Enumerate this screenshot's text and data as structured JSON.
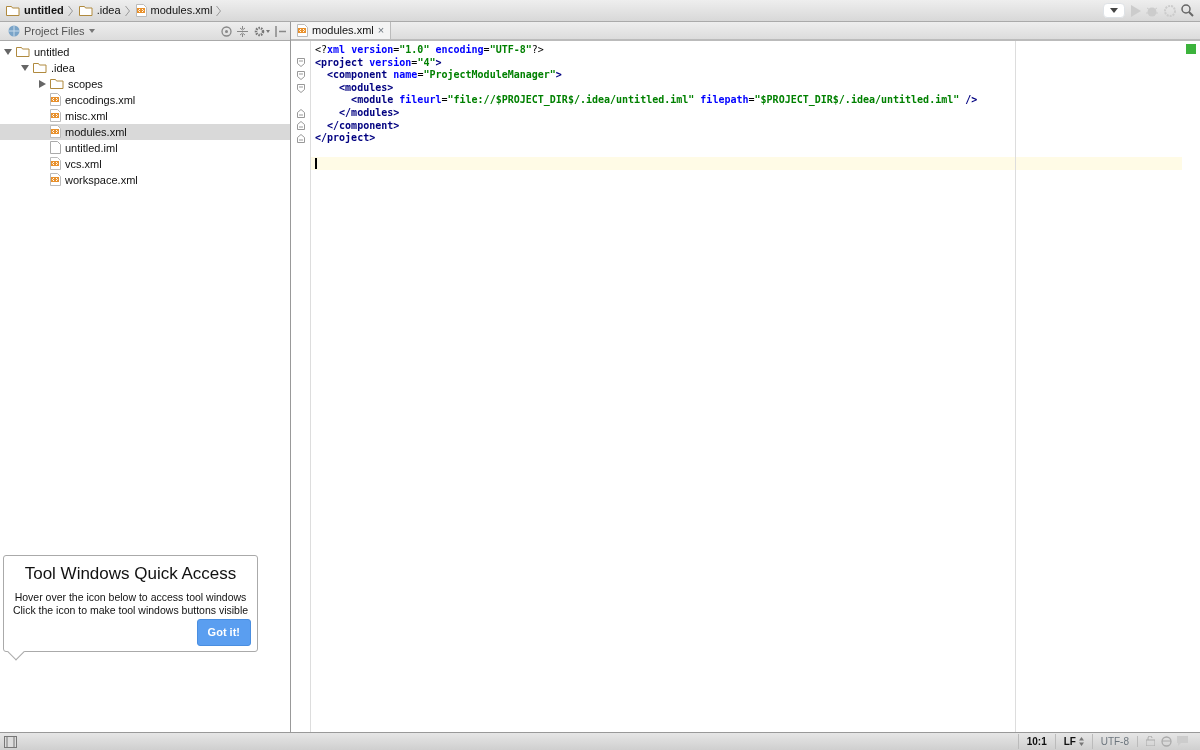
{
  "breadcrumbs": [
    {
      "label": "untitled",
      "kind": "folder",
      "bold": true
    },
    {
      "label": ".idea",
      "kind": "folder",
      "bold": false
    },
    {
      "label": "modules.xml",
      "kind": "xml",
      "bold": false
    }
  ],
  "project_panel": {
    "view_selector": "Project Files",
    "tree": [
      {
        "label": "untitled",
        "kind": "folder",
        "expanded": true,
        "selected": false,
        "children": [
          {
            "label": ".idea",
            "kind": "folder",
            "expanded": true,
            "selected": false,
            "children": [
              {
                "label": "scopes",
                "kind": "folder",
                "expanded": false,
                "selected": false
              },
              {
                "label": "encodings.xml",
                "kind": "xml",
                "selected": false
              },
              {
                "label": "misc.xml",
                "kind": "xml",
                "selected": false
              },
              {
                "label": "modules.xml",
                "kind": "xml",
                "selected": true
              },
              {
                "label": "untitled.iml",
                "kind": "file",
                "selected": false
              },
              {
                "label": "vcs.xml",
                "kind": "xml",
                "selected": false
              },
              {
                "label": "workspace.xml",
                "kind": "xml",
                "selected": false
              }
            ]
          }
        ]
      }
    ]
  },
  "editor_tabs": [
    {
      "label": "modules.xml",
      "selected": true,
      "close": "×"
    }
  ],
  "code_lines": [
    {
      "kind": "plain",
      "tokens": [
        {
          "t": "<?",
          "kind": "plain"
        },
        {
          "t": "xml version",
          "kind": "attr"
        },
        {
          "t": "=",
          "kind": "plain"
        },
        {
          "t": "\"1.0\"",
          "kind": "value"
        },
        {
          "t": " encoding",
          "kind": "attr"
        },
        {
          "t": "=",
          "kind": "plain"
        },
        {
          "t": "\"UTF-8\"",
          "kind": "value"
        },
        {
          "t": "?>",
          "kind": "plain"
        }
      ]
    },
    {
      "kind": "fold_start",
      "tokens": [
        {
          "t": "<project ",
          "kind": "tag"
        },
        {
          "t": "version",
          "kind": "attr"
        },
        {
          "t": "=",
          "kind": "plain"
        },
        {
          "t": "\"4\"",
          "kind": "value"
        },
        {
          "t": ">",
          "kind": "tag"
        }
      ]
    },
    {
      "kind": "fold_start",
      "tokens": [
        {
          "t": "  <component ",
          "kind": "tag"
        },
        {
          "t": "name",
          "kind": "attr"
        },
        {
          "t": "=",
          "kind": "plain"
        },
        {
          "t": "\"ProjectModuleManager\"",
          "kind": "value"
        },
        {
          "t": ">",
          "kind": "tag"
        }
      ]
    },
    {
      "kind": "fold_start",
      "tokens": [
        {
          "t": "    <modules>",
          "kind": "tag"
        }
      ]
    },
    {
      "kind": "plain",
      "tokens": [
        {
          "t": "      <module ",
          "kind": "tag"
        },
        {
          "t": "fileurl",
          "kind": "attr"
        },
        {
          "t": "=",
          "kind": "plain"
        },
        {
          "t": "\"file://$PROJECT_DIR$/.idea/untitled.iml\"",
          "kind": "value"
        },
        {
          "t": " filepath",
          "kind": "attr"
        },
        {
          "t": "=",
          "kind": "plain"
        },
        {
          "t": "\"$PROJECT_DIR$/.idea/untitled.iml\"",
          "kind": "value"
        },
        {
          "t": " />",
          "kind": "tag"
        }
      ]
    },
    {
      "kind": "fold_end",
      "tokens": [
        {
          "t": "    </modules>",
          "kind": "tag"
        }
      ]
    },
    {
      "kind": "fold_end",
      "tokens": [
        {
          "t": "  </component>",
          "kind": "tag"
        }
      ]
    },
    {
      "kind": "fold_end",
      "tokens": [
        {
          "t": "</project>",
          "kind": "tag"
        }
      ]
    },
    {
      "kind": "blank"
    },
    {
      "kind": "blank",
      "caret": true
    }
  ],
  "popup": {
    "title": "Tool Windows Quick Access",
    "lines": [
      "Hover over the icon below to access tool windows",
      "Click the icon to make tool windows buttons visible"
    ],
    "button": "Got it!"
  },
  "status_bar": {
    "position": "10:1",
    "line_separator": "LF",
    "encoding": "UTF-8"
  }
}
